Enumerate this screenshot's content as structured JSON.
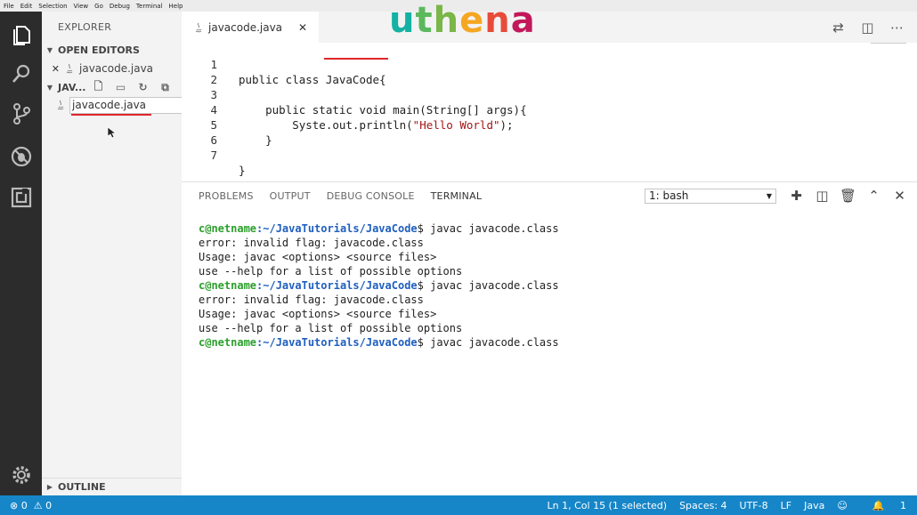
{
  "menu": [
    "File",
    "Edit",
    "Selection",
    "View",
    "Go",
    "Debug",
    "Terminal",
    "Help"
  ],
  "logo": [
    "u",
    "t",
    "h",
    "e",
    "n",
    "a"
  ],
  "sidebar": {
    "title": "EXPLORER",
    "open_editors_label": "OPEN EDITORS",
    "open_editor_file": "javacode.java",
    "workspace_label": "JAV...",
    "file_input_value": "javacode.java",
    "outline_label": "OUTLINE"
  },
  "tab": {
    "label": "javacode.java"
  },
  "editor": {
    "lines": [
      {
        "n": "1",
        "text": "public class JavaCode{"
      },
      {
        "n": "2",
        "text": ""
      },
      {
        "n": "3",
        "text": "    public static void main(String[] args){"
      },
      {
        "n": "4",
        "text_pre": "        Syste.out.println(",
        "string": "\"Hello World\"",
        "text_post": ");"
      },
      {
        "n": "5",
        "text": "    }"
      },
      {
        "n": "6",
        "text": ""
      },
      {
        "n": "7",
        "text": "}"
      }
    ]
  },
  "panel": {
    "tabs": [
      "PROBLEMS",
      "OUTPUT",
      "DEBUG CONSOLE",
      "TERMINAL"
    ],
    "active_tab": "TERMINAL",
    "terminal_select": "1: bash",
    "terminal_lines": [
      {
        "user": "c@netname",
        "path": ":~/JavaTutorials/JavaCode",
        "cmd": "$ javac javacode.class"
      },
      {
        "out": "error: invalid flag: javacode.class"
      },
      {
        "out": "Usage: javac <options> <source files>"
      },
      {
        "out": "use --help for a list of possible options"
      },
      {
        "user": "c@netname",
        "path": ":~/JavaTutorials/JavaCode",
        "cmd": "$ javac javacode.class"
      },
      {
        "out": "error: invalid flag: javacode.class"
      },
      {
        "out": "Usage: javac <options> <source files>"
      },
      {
        "out": "use --help for a list of possible options"
      },
      {
        "user": "c@netname",
        "path": ":~/JavaTutorials/JavaCode",
        "cmd": "$ javac javacode.class"
      }
    ]
  },
  "status": {
    "errors": "0",
    "warnings": "0",
    "position": "Ln 1, Col 15 (1 selected)",
    "spaces": "Spaces: 4",
    "encoding": "UTF-8",
    "eol": "LF",
    "language": "Java",
    "notifications": "1"
  },
  "colors": {
    "accent": "#1686c8",
    "activity_bar": "#2c2c2c",
    "annotation_red": "#e0262b"
  }
}
